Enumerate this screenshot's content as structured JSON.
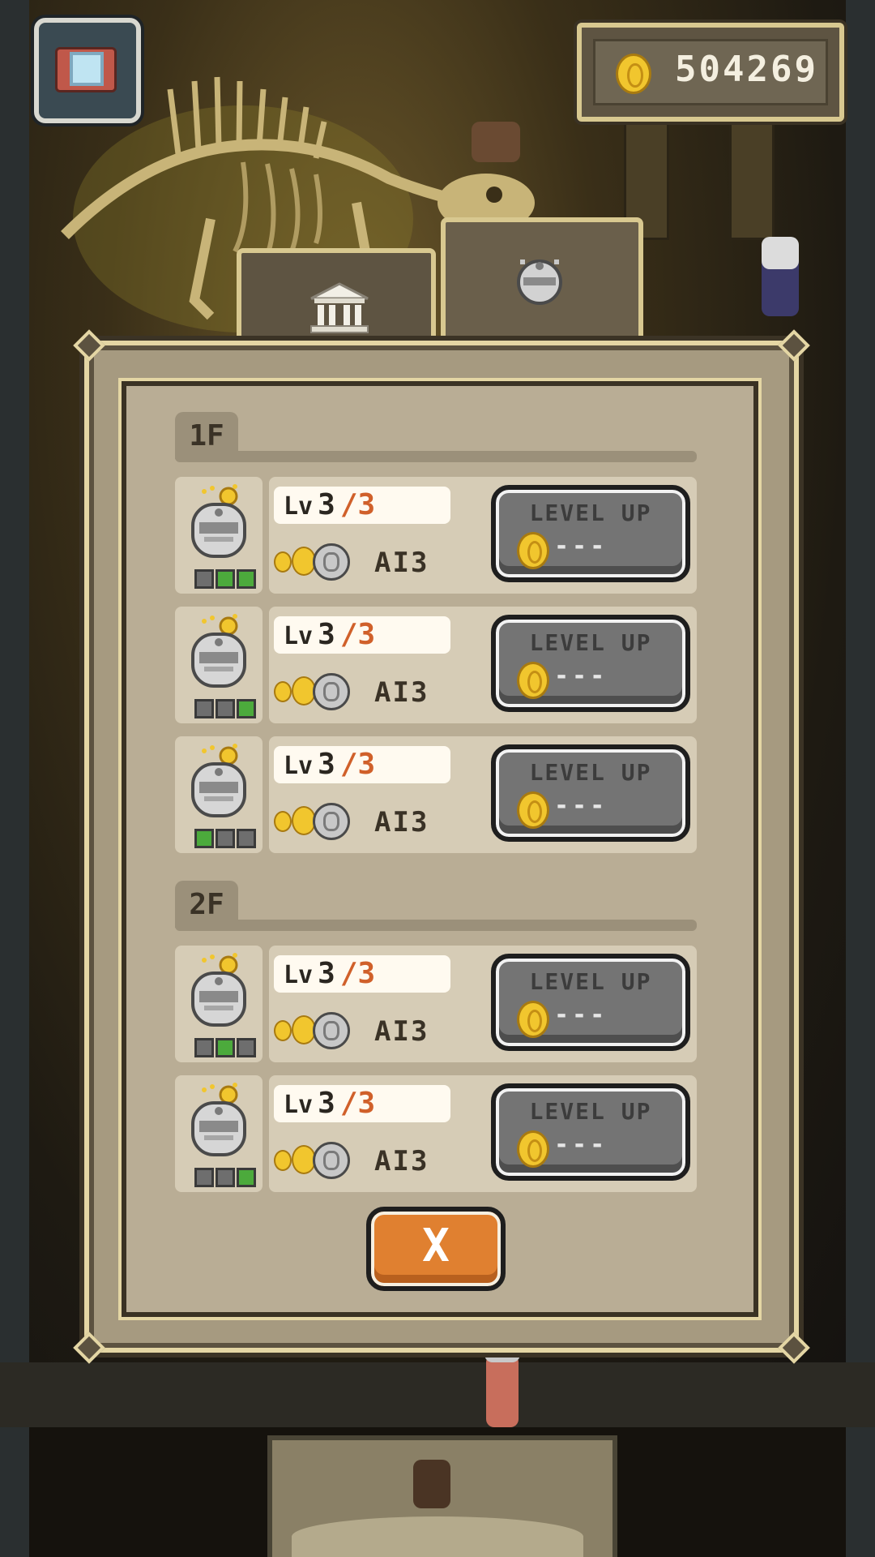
{
  "coins": {
    "amount": "504269"
  },
  "tabs": [
    {
      "name": "museum",
      "icon": "museum-building-icon"
    },
    {
      "name": "robots",
      "icon": "robot-cleaner-icon",
      "active": true
    }
  ],
  "floors": [
    {
      "label": "1F",
      "robots": [
        {
          "lv_label": "Lv",
          "level": "3",
          "max": "/3",
          "ai": "AI3",
          "button": "LEVEL UP",
          "cost": "---",
          "slots": [
            false,
            true,
            true
          ]
        },
        {
          "lv_label": "Lv",
          "level": "3",
          "max": "/3",
          "ai": "AI3",
          "button": "LEVEL UP",
          "cost": "---",
          "slots": [
            false,
            false,
            true
          ]
        },
        {
          "lv_label": "Lv",
          "level": "3",
          "max": "/3",
          "ai": "AI3",
          "button": "LEVEL UP",
          "cost": "---",
          "slots": [
            true,
            false,
            false
          ]
        }
      ]
    },
    {
      "label": "2F",
      "robots": [
        {
          "lv_label": "Lv",
          "level": "3",
          "max": "/3",
          "ai": "AI3",
          "button": "LEVEL UP",
          "cost": "---",
          "slots": [
            false,
            true,
            false
          ]
        },
        {
          "lv_label": "Lv",
          "level": "3",
          "max": "/3",
          "ai": "AI3",
          "button": "LEVEL UP",
          "cost": "---",
          "slots": [
            false,
            false,
            true
          ]
        }
      ]
    }
  ],
  "close": {
    "label": "X"
  },
  "colors": {
    "panel": "#b9ad95",
    "gold": "#f1c62e",
    "accent_orange": "#e08030",
    "level_max": "#d0602a",
    "slot_on": "#4caa3c"
  }
}
